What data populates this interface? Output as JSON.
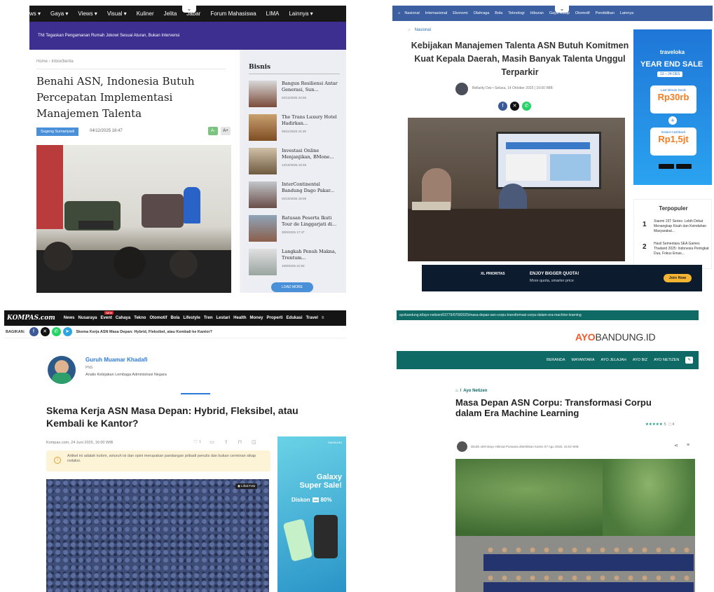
{
  "panel1": {
    "nav": [
      "ws ▾",
      "Gaya ▾",
      "Views ▾",
      "Visual ▾",
      "Kuliner",
      "Jelita",
      "Jabar",
      "Forum Mahasiswa",
      "LIMA",
      "Lainnya ▾"
    ],
    "ticker": "TNI Tegaskan Pengamanan Rumah Jokowi Sesuai Aturan, Bukan Intervensi",
    "breadcrumb": "Home  ›  Inbox/berita",
    "title": "Benahi ASN, Indonesia Butuh Percepatan Implementasi Manajemen Talenta",
    "author": "Sugeng Sumariyadi",
    "date": "04/12/2025 18:47",
    "font_small": "A-",
    "font_large": "A+",
    "sidebar_title": "Bisnis",
    "sidebar_items": [
      {
        "title": "Bangun Resiliensi Antar Generasi, Sun...",
        "date": "02/12/2025 22:56"
      },
      {
        "title": "The Trans Luxury Hotel Hadirkan...",
        "date": "06/11/2025 22:49"
      },
      {
        "title": "Investasi Online Menjanjikan, BMone...",
        "date": "12/10/2025 19:48"
      },
      {
        "title": "InterContinental Bandung Dago Pakar...",
        "date": "02/10/2025 18:09"
      },
      {
        "title": "Ratusan Peserta Ikuti Tour de Linggarjati di...",
        "date": "30/9/2025 17:47"
      },
      {
        "title": "Langkah Penuh Makna, Trentum...",
        "date": "15/9/2025 21:50"
      }
    ],
    "load_more": "LOAD MORE"
  },
  "panel2": {
    "nav": [
      "Nasional",
      "Internasional",
      "Ekonomi",
      "Olahraga",
      "Bola",
      "Teknologi",
      "Hiburan",
      "Gaya Hidup",
      "Otomotif",
      "Pendidikan",
      "Lainnya"
    ],
    "category": "Nasional",
    "title": "Kebijakan Manajemen Talenta ASN Butuh Komitmen Kuat Kepala Daerah, Masih Banyak Talenta Unggul Terparkir",
    "byline": "Bellarity Dwi  •  Selasa, 14 Oktober 2025 | 16:00 WIB",
    "ad": {
      "brand": "traveloka",
      "headline": "YEAR END SALE",
      "period": "13 – 24 DES",
      "offer1": "Rp30rb",
      "offer1_label": "Last Minute Deals",
      "offer2": "Rp1,5jt",
      "offer2_label": "Instant Cashback"
    },
    "popular_title": "Terpopuler",
    "popular": [
      {
        "rank": "1",
        "title": "Xiaomi 15T Series: Lebih Dekat Menangkap Kisah dan Keindahan Masyarakat..."
      },
      {
        "rank": "2",
        "title": "Hasil Sementara SEA Games Thailand 2025: Indonesia Peringkat Dua, Fokus Emas..."
      }
    ],
    "bottom_ad": {
      "brand": "XL PRIORITAS",
      "headline": "ENJOY BIGGER QUOTA!",
      "sub": "More quota, smarter price",
      "cta": "Join Now"
    }
  },
  "panel3": {
    "logo": "KOMPAS.com",
    "nav": [
      "News",
      "Nusaraya",
      "Event",
      "Cahaya",
      "Tekno",
      "Otomotif",
      "Bola",
      "Lifestyle",
      "Tren",
      "Lestari",
      "Health",
      "Money",
      "Properti",
      "Edukasi",
      "Travel"
    ],
    "new_badge": "NEW",
    "share_label": "BAGIKAN:",
    "share_title": "Skema Kerja ASN Masa Depan: Hybrid, Fleksibel, atau Kembali ke Kantor?",
    "author_name": "Guruh Muamar Khadafi",
    "author_role": "PNS",
    "author_desc": "Analis Kebijakan Lembaga Administrasi Negara",
    "title": "Skema Kerja ASN Masa Depan: Hybrid, Fleksibel, atau Kembali ke Kantor?",
    "meta": "Kompas.com, 24 Juni 2025, 16:00 WIB",
    "like_count": "1",
    "notice": "Artikel ini adalah kolom, seluruh isi dan opini merupakan pandangan pribadi penulis dan bukan cerminan sikap redaksi.",
    "photo_tag": "Lihat Foto",
    "ad": {
      "brand": "SAMSUNG",
      "headline": "Galaxy Super Sale!",
      "discount_label": "Diskon",
      "discount_prefix": "s/d",
      "discount_value": "80%"
    }
  },
  "panel4": {
    "url": "ayobandung.id/ayo-netizen/03779/07082025/masa-depan-asn-corpu-transformasi-corpu-dalam-era-machine-learning",
    "logo_a": "AYO",
    "logo_b": "BANDUNG.ID",
    "menu": [
      "BERANDA",
      "MAYANTARA",
      "AYO JELAJAH",
      "AYO BIZ",
      "AYO NETIZEN"
    ],
    "category": "Ayo Netizen",
    "title": "Masa Depan ASN Corpu: Transformasi Corpu dalam Era Machine Learning",
    "rating_stars": "★★★★★",
    "rating_value": "5",
    "rating_count": "4",
    "byline": "Ditulis oleh Bayu Hikmat Purwana diterbitkan Kamis 07 Agu 2025, 15:02 WIB"
  },
  "colors": {
    "p1_ticker": "#3c2f8f",
    "p2_nav": "#3b5fa0",
    "kompas_blue": "#2c7bd9",
    "ayo_green": "#0f6a66",
    "ayo_orange": "#f25a29"
  }
}
